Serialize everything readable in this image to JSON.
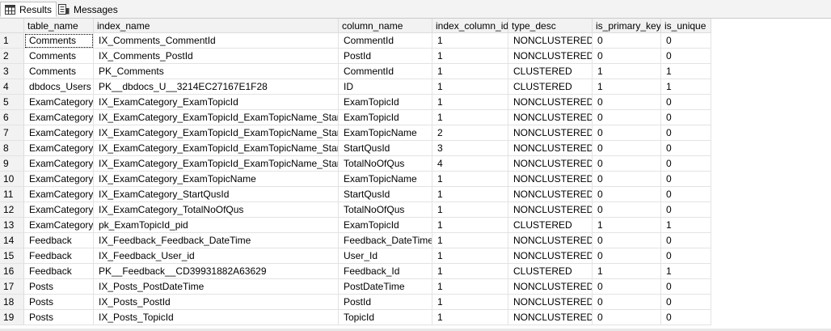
{
  "tabs": [
    {
      "label": "Results",
      "icon": "grid-icon",
      "active": true
    },
    {
      "label": "Messages",
      "icon": "messages-icon",
      "active": false
    }
  ],
  "columns": [
    "table_name",
    "index_name",
    "column_name",
    "index_column_id",
    "type_desc",
    "is_primary_key",
    "is_unique"
  ],
  "rows": [
    [
      "1",
      "Comments",
      "IX_Comments_CommentId",
      "CommentId",
      "1",
      "NONCLUSTERED",
      "0",
      "0"
    ],
    [
      "2",
      "Comments",
      "IX_Comments_PostId",
      "PostId",
      "1",
      "NONCLUSTERED",
      "0",
      "0"
    ],
    [
      "3",
      "Comments",
      "PK_Comments",
      "CommentId",
      "1",
      "CLUSTERED",
      "1",
      "1"
    ],
    [
      "4",
      "dbdocs_Users",
      "PK__dbdocs_U__3214EC27167E1F28",
      "ID",
      "1",
      "CLUSTERED",
      "1",
      "1"
    ],
    [
      "5",
      "ExamCategory",
      "IX_ExamCategory_ExamTopicId",
      "ExamTopicId",
      "1",
      "NONCLUSTERED",
      "0",
      "0"
    ],
    [
      "6",
      "ExamCategory",
      "IX_ExamCategory_ExamTopicId_ExamTopicName_StartQ...",
      "ExamTopicId",
      "1",
      "NONCLUSTERED",
      "0",
      "0"
    ],
    [
      "7",
      "ExamCategory",
      "IX_ExamCategory_ExamTopicId_ExamTopicName_StartQ...",
      "ExamTopicName",
      "2",
      "NONCLUSTERED",
      "0",
      "0"
    ],
    [
      "8",
      "ExamCategory",
      "IX_ExamCategory_ExamTopicId_ExamTopicName_StartQ...",
      "StartQusId",
      "3",
      "NONCLUSTERED",
      "0",
      "0"
    ],
    [
      "9",
      "ExamCategory",
      "IX_ExamCategory_ExamTopicId_ExamTopicName_StartQ...",
      "TotalNoOfQus",
      "4",
      "NONCLUSTERED",
      "0",
      "0"
    ],
    [
      "10",
      "ExamCategory",
      "IX_ExamCategory_ExamTopicName",
      "ExamTopicName",
      "1",
      "NONCLUSTERED",
      "0",
      "0"
    ],
    [
      "11",
      "ExamCategory",
      "IX_ExamCategory_StartQusId",
      "StartQusId",
      "1",
      "NONCLUSTERED",
      "0",
      "0"
    ],
    [
      "12",
      "ExamCategory",
      "IX_ExamCategory_TotalNoOfQus",
      "TotalNoOfQus",
      "1",
      "NONCLUSTERED",
      "0",
      "0"
    ],
    [
      "13",
      "ExamCategory",
      "pk_ExamTopicId_pid",
      "ExamTopicId",
      "1",
      "CLUSTERED",
      "1",
      "1"
    ],
    [
      "14",
      "Feedback",
      "IX_Feedback_Feedback_DateTime",
      "Feedback_DateTime",
      "1",
      "NONCLUSTERED",
      "0",
      "0"
    ],
    [
      "15",
      "Feedback",
      "IX_Feedback_User_id",
      "User_Id",
      "1",
      "NONCLUSTERED",
      "0",
      "0"
    ],
    [
      "16",
      "Feedback",
      "PK__Feedback__CD39931882A63629",
      "Feedback_Id",
      "1",
      "CLUSTERED",
      "1",
      "1"
    ],
    [
      "17",
      "Posts",
      "IX_Posts_PostDateTime",
      "PostDateTime",
      "1",
      "NONCLUSTERED",
      "0",
      "0"
    ],
    [
      "18",
      "Posts",
      "IX_Posts_PostId",
      "PostId",
      "1",
      "NONCLUSTERED",
      "0",
      "0"
    ],
    [
      "19",
      "Posts",
      "IX_Posts_TopicId",
      "TopicId",
      "1",
      "NONCLUSTERED",
      "0",
      "0"
    ]
  ],
  "selected_cell": {
    "row": 0,
    "col": 1
  }
}
